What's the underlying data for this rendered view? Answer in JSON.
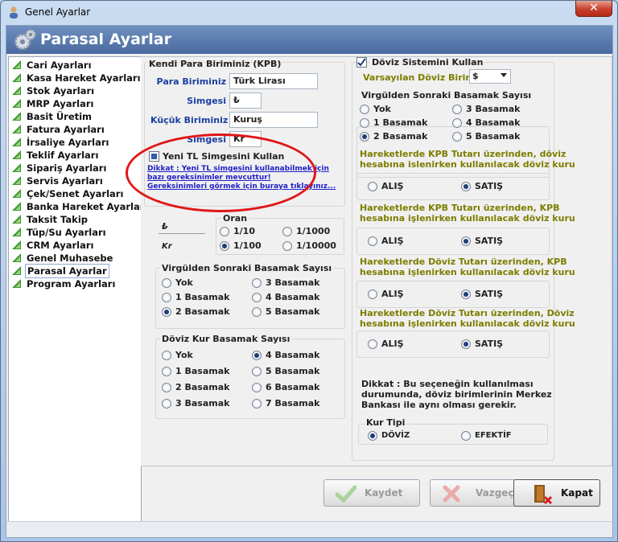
{
  "window": {
    "title": "Genel Ayarlar",
    "close_label": "✕"
  },
  "header": {
    "title": "Parasal Ayarlar"
  },
  "sidebar": {
    "items": [
      {
        "label": "Cari Ayarları"
      },
      {
        "label": "Kasa Hareket Ayarları"
      },
      {
        "label": "Stok Ayarları"
      },
      {
        "label": "MRP Ayarları"
      },
      {
        "label": "Basit Üretim"
      },
      {
        "label": "Fatura Ayarları"
      },
      {
        "label": "İrsaliye Ayarları"
      },
      {
        "label": "Teklif Ayarları"
      },
      {
        "label": "Sipariş Ayarları"
      },
      {
        "label": "Servis Ayarları"
      },
      {
        "label": "Çek/Senet Ayarları"
      },
      {
        "label": "Banka Hareket Ayarları"
      },
      {
        "label": "Taksit Takip"
      },
      {
        "label": "Tüp/Su Ayarları"
      },
      {
        "label": "CRM Ayarları"
      },
      {
        "label": "Genel Muhasebe"
      },
      {
        "label": "Parasal Ayarlar"
      },
      {
        "label": "Program Ayarları"
      }
    ],
    "selected": "Parasal Ayarlar"
  },
  "kpb": {
    "title": "Kendi Para Biriminiz (KPB)",
    "para_birimi_label": "Para Biriminiz",
    "para_birimi_value": "Türk Lirası",
    "simgesi_label": "Simgesi",
    "simgesi_value": "₺",
    "kucuk_label": "Küçük Biriminiz",
    "kucuk_value": "Kuruş",
    "simgesi2_label": "Simgesi",
    "simgesi2_value": "Kr",
    "yeni_tl_label": "Yeni TL Simgesini Kullan",
    "dikkat_link_1": "Dikkat : Yeni TL simgesini kullanabilmek için",
    "dikkat_link_2": "bazı gereksinimler mevcuttur!",
    "dikkat_link_3": "Gereksinimleri görmek için buraya tıklayınız..."
  },
  "oran": {
    "title": "Oran",
    "symbol_top": "₺",
    "symbol_bottom": "Kr",
    "options": [
      "1/10",
      "1/1000",
      "1/100",
      "1/10000"
    ],
    "selected": "1/100"
  },
  "virgul": {
    "title": "Virgülden Sonraki Basamak Sayısı",
    "options": [
      "Yok",
      "3 Basamak",
      "1 Basamak",
      "4 Basamak",
      "2 Basamak",
      "5 Basamak"
    ],
    "selected": "2 Basamak"
  },
  "dovizkur": {
    "title": "Döviz Kur Basamak Sayısı",
    "options": [
      "Yok",
      "4 Basamak",
      "1 Basamak",
      "5 Basamak",
      "2 Basamak",
      "6 Basamak",
      "3 Basamak",
      "7 Basamak"
    ],
    "selected": "4 Basamak"
  },
  "doviz": {
    "title": "Döviz Sistemini Kullan",
    "checked": true,
    "varsayilan_label": "Varsayılan Döviz Birimi",
    "varsayilan_value": "$",
    "virgul_title": "Virgülden Sonraki Basamak Sayısı",
    "virgul_options": [
      "Yok",
      "3 Basamak",
      "1 Basamak",
      "4 Basamak",
      "2 Basamak",
      "5 Basamak"
    ],
    "virgul_selected": "2 Basamak",
    "sections": [
      {
        "line1": "Hareketlerde KPB Tutarı üzerinden, döviz",
        "line2": "hesabına islenirken kullanılacak döviz kuru",
        "alis": "ALIŞ",
        "satis": "SATIŞ",
        "selected": "SATIŞ"
      },
      {
        "line1": "Hareketlerde KPB Tutarı üzerinden, KPB",
        "line2": "hesabına işlenirken kullanılacak döviz kuru",
        "alis": "ALIŞ",
        "satis": "SATIŞ",
        "selected": "SATIŞ"
      },
      {
        "line1": "Hareketlerde Döviz Tutarı üzerinden, KPB",
        "line2": "hesabına işlenirken kullanılacak döviz kuru",
        "alis": "ALIŞ",
        "satis": "SATIŞ",
        "selected": "SATIŞ"
      },
      {
        "line1": "Hareketlerde Döviz Tutarı üzerinden, Döviz",
        "line2": "hesabına işlenirken kullanılacak döviz kuru",
        "alis": "ALIŞ",
        "satis": "SATIŞ",
        "selected": "SATIŞ"
      }
    ],
    "dikkat_1": "Dikkat : Bu seçeneğin kullanılması",
    "dikkat_2": "durumunda, döviz birimlerinin Merkez",
    "dikkat_3": "Bankası ile aynı olması gerekir.",
    "kur_tipi_title": "Kur Tipi",
    "kur_doviz": "DÖVİZ",
    "kur_efektif": "EFEKTİF",
    "kur_selected": "DÖVİZ"
  },
  "buttons": {
    "kaydet": "Kaydet",
    "vazgec": "Vazgeç",
    "kapat": "Kapat"
  },
  "colors": {
    "header": "#5677ab",
    "highlight_oval": "#e01616",
    "olive_text": "#7d7d00",
    "link": "#2121c7"
  }
}
